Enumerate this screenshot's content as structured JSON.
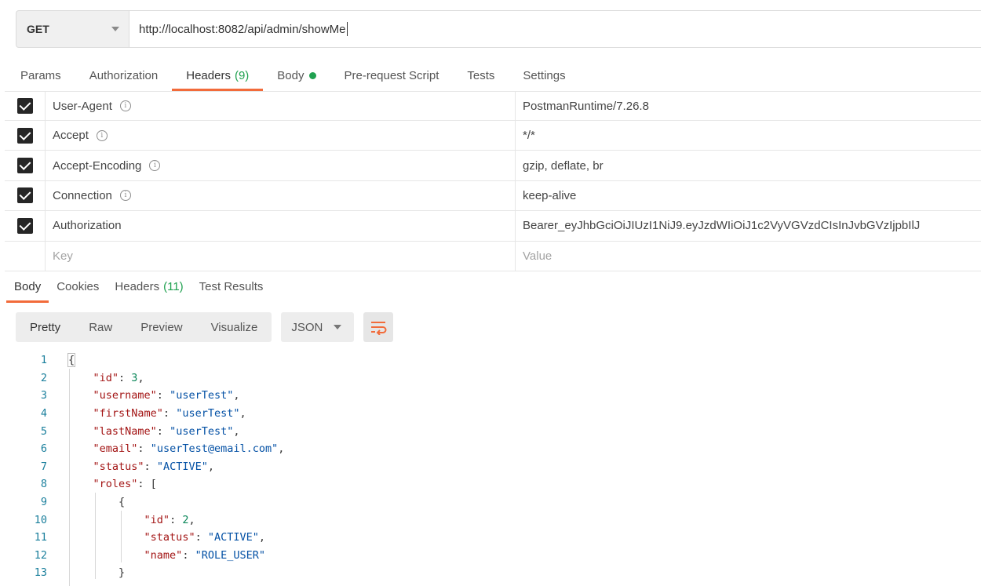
{
  "request": {
    "method": "GET",
    "url": "http://localhost:8082/api/admin/showMe"
  },
  "request_tabs": [
    {
      "label": "Params"
    },
    {
      "label": "Authorization"
    },
    {
      "label": "Headers",
      "count": "(9)"
    },
    {
      "label": "Body"
    },
    {
      "label": "Pre-request Script"
    },
    {
      "label": "Tests"
    },
    {
      "label": "Settings"
    }
  ],
  "headers": [
    {
      "key": "User-Agent",
      "value": "PostmanRuntime/7.26.8"
    },
    {
      "key": "Accept",
      "value": "*/*"
    },
    {
      "key": "Accept-Encoding",
      "value": "gzip, deflate, br"
    },
    {
      "key": "Connection",
      "value": "keep-alive"
    },
    {
      "key": "Authorization",
      "value": "Bearer_eyJhbGciOiJIUzI1NiJ9.eyJzdWIiOiJ1c2VyVGVzdCIsInJvbGVzIjpbIlJ"
    }
  ],
  "new_header": {
    "key_placeholder": "Key",
    "value_placeholder": "Value"
  },
  "response_tabs": [
    {
      "label": "Body"
    },
    {
      "label": "Cookies"
    },
    {
      "label": "Headers",
      "count": "(11)"
    },
    {
      "label": "Test Results"
    }
  ],
  "view_modes": [
    "Pretty",
    "Raw",
    "Preview",
    "Visualize"
  ],
  "format": "JSON",
  "code_lines": [
    "1",
    "2",
    "3",
    "4",
    "5",
    "6",
    "7",
    "8",
    "9",
    "10",
    "11",
    "12",
    "13"
  ],
  "json": {
    "id_key": "\"id\"",
    "id_val": "3",
    "username_key": "\"username\"",
    "username_val": "\"userTest\"",
    "firstName_key": "\"firstName\"",
    "firstName_val": "\"userTest\"",
    "lastName_key": "\"lastName\"",
    "lastName_val": "\"userTest\"",
    "email_key": "\"email\"",
    "email_val": "\"userTest@email.com\"",
    "status_key": "\"status\"",
    "status_val": "\"ACTIVE\"",
    "roles_key": "\"roles\"",
    "role_id_key": "\"id\"",
    "role_id_val": "2",
    "role_status_key": "\"status\"",
    "role_status_val": "\"ACTIVE\"",
    "role_name_key": "\"name\"",
    "role_name_val": "\"ROLE_USER\""
  },
  "colors": {
    "accent": "#f26b3a",
    "green": "#20a150",
    "line_number": "#1a7f9c",
    "json_key": "#a31515",
    "json_string": "#0451a5",
    "json_number": "#098658"
  }
}
